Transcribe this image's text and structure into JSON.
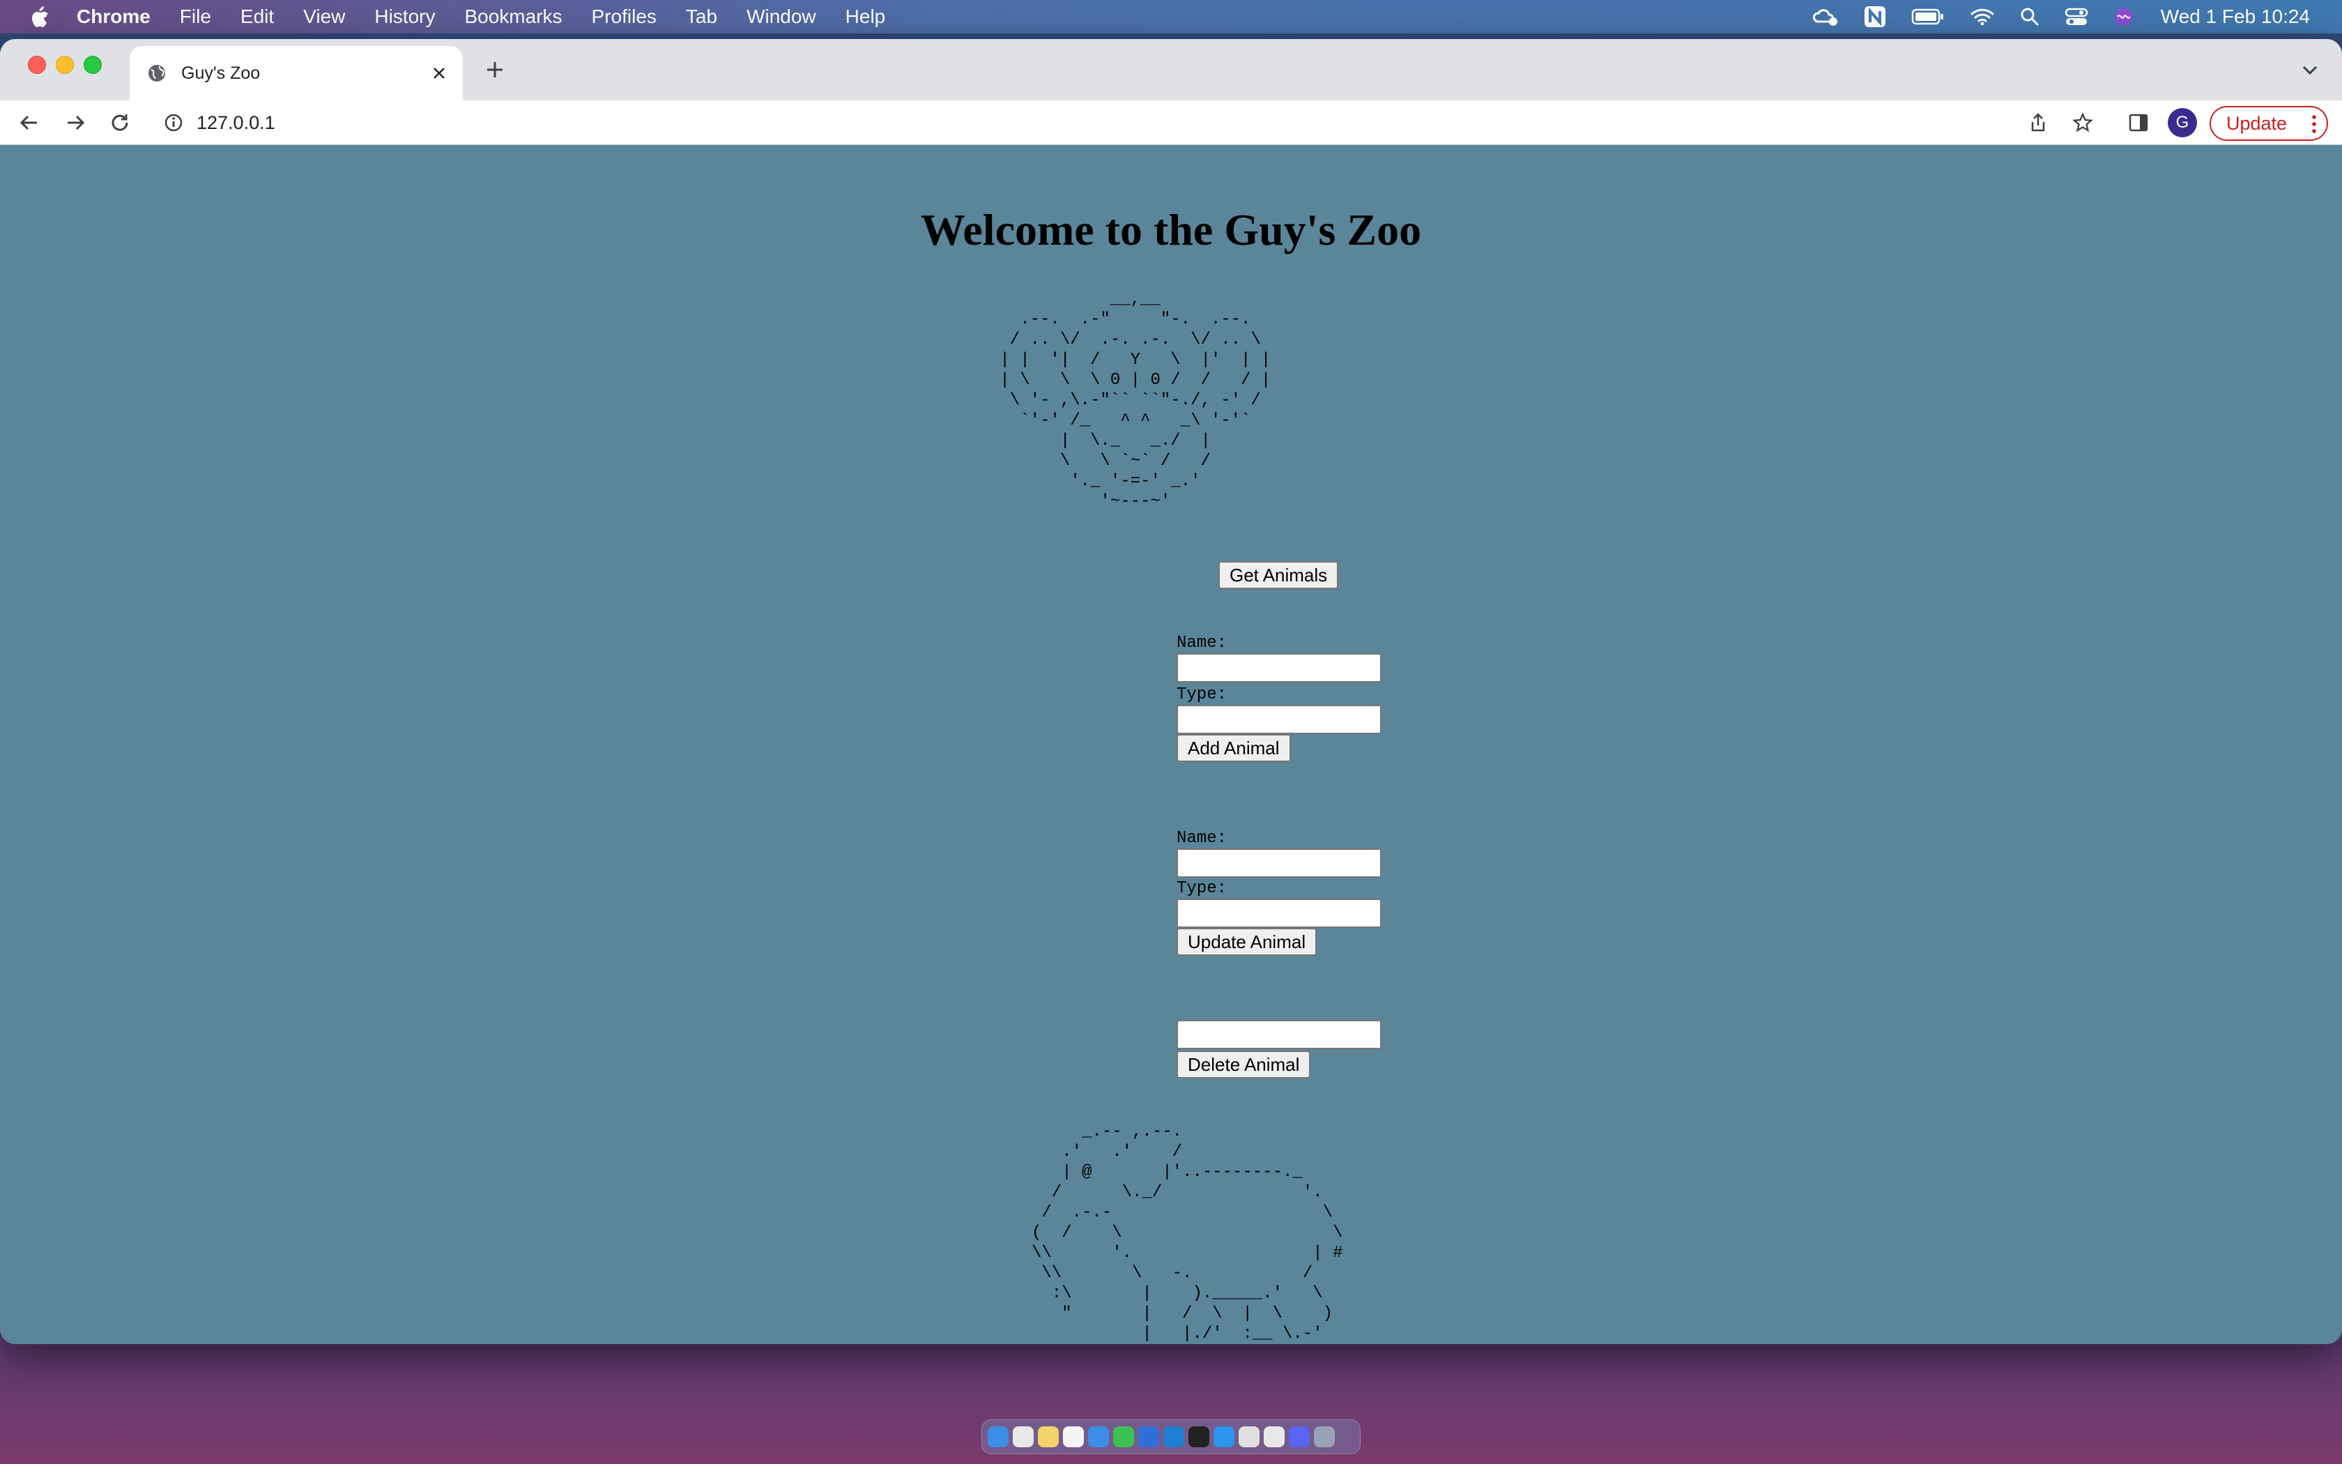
{
  "menubar": {
    "app_name": "Chrome",
    "items": [
      "File",
      "Edit",
      "View",
      "History",
      "Bookmarks",
      "Profiles",
      "Tab",
      "Window",
      "Help"
    ],
    "clock": "Wed 1 Feb  10:24"
  },
  "browser": {
    "tab_title": "Guy's Zoo",
    "url": "127.0.0.1",
    "avatar_letter": "G",
    "update_label": "Update"
  },
  "page": {
    "title": "Welcome to the Guy's Zoo",
    "monkey_art": "            __,__\n   .--.  .-\"     \"-.  .--.\n  / .. \\/  .-. .-.  \\/ .. \\\n | |  '|  /   Y   \\  |'  | |\n | \\   \\  \\ 0 | 0 /  /   / |\n  \\ '- ,\\.-\"`` ``\"-./, -' /\n   `'-' /_   ^ ^   _\\ '-'`\n       |  \\._   _./  |\n       \\   \\ `~` /   /\n        '._ '-=-' _.'\n           '~---~'",
    "get_animals_label": "Get Animals",
    "add_form": {
      "name_label": "Name:",
      "type_label": "Type:",
      "name_value": "",
      "type_value": "",
      "submit_label": "Add Animal"
    },
    "update_form": {
      "name_label": "Name:",
      "type_label": "Type:",
      "name_value": "",
      "type_value": "",
      "submit_label": "Update Animal"
    },
    "delete_form": {
      "value": "",
      "submit_label": "Delete Animal"
    },
    "elephant_art": "     _.-- ,.--.\n   .'   .'    /\n   | @       |'..--------._\n  /      \\._/              '.\n /  .-.-                     \\\n(  /    \\                     \\\n\\\\      '.                  | #\n \\\\       \\   -.           /\n  :\\       |    )._____.'   \\\n   \"       |   /  \\  |  \\    )\n           |   |./'  :__ \\.-'\n           '--'"
  },
  "colors": {
    "page_background": "#5b8699",
    "update_button": "#c5221f",
    "avatar": "#3c2a8f"
  }
}
